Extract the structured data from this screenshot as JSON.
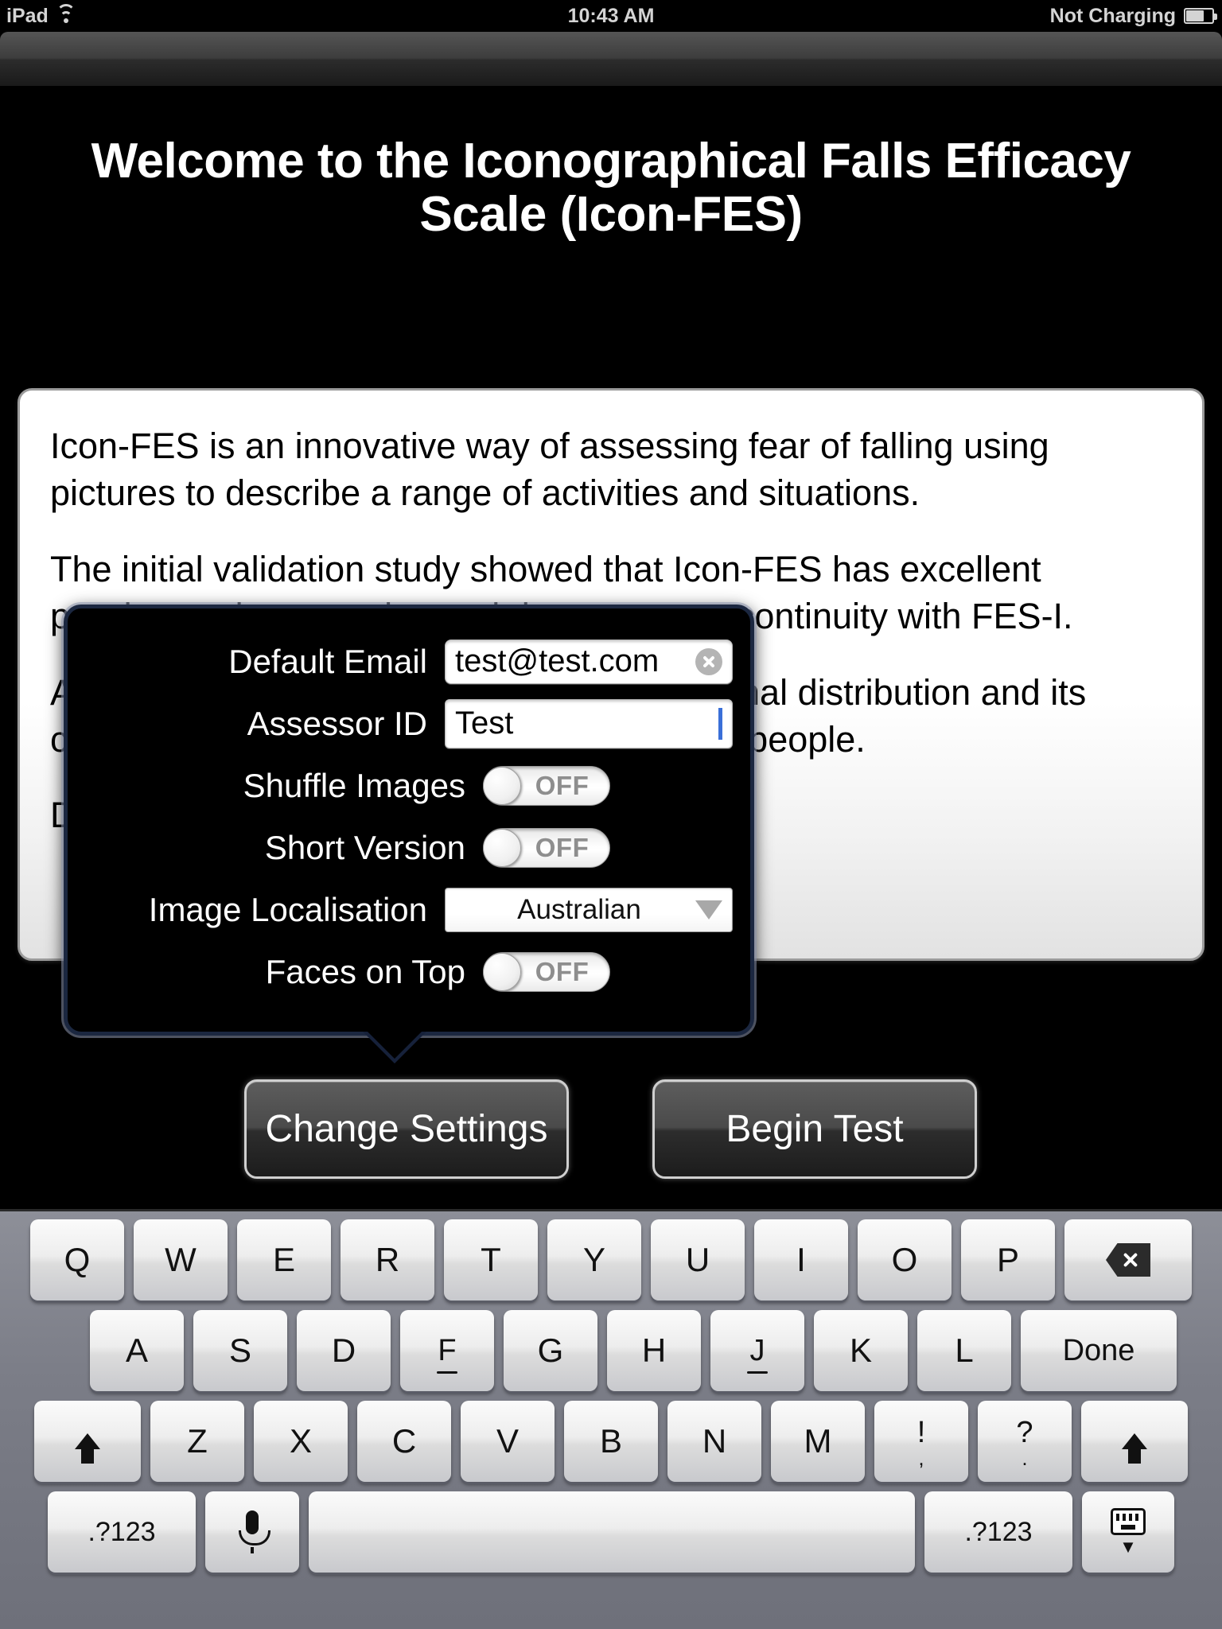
{
  "statusbar": {
    "device": "iPad",
    "wifi_icon": "wifi-icon",
    "time": "10:43 AM",
    "battery_text": "Not Charging",
    "battery_icon": "battery-icon"
  },
  "page_title": "Welcome to the Iconographical Falls Efficacy Scale (Icon-FES)",
  "info_card": {
    "paragraphs": [
      "Icon-FES is an innovative way of assessing fear of falling using pictures to describe a range of activities and situations.",
      "The initial validation study showed that Icon-FES has excellent psychometric properties and demonstrates continuity with FES-I.",
      "Additionally, the Icon-FES scores show normal distribution and its ceiling effect is low in high-functioning older people.",
      "Download the manual here."
    ]
  },
  "settings_popover": {
    "rows": [
      {
        "label": "Default Email",
        "type": "text",
        "value": "test@test.com",
        "clear_icon": "clear-circle-icon"
      },
      {
        "label": "Assessor ID",
        "type": "text",
        "value": "Test",
        "caret": true
      },
      {
        "label": "Shuffle Images",
        "type": "toggle",
        "value": "OFF"
      },
      {
        "label": "Short Version",
        "type": "toggle",
        "value": "OFF"
      },
      {
        "label": "Image Localisation",
        "type": "select",
        "value": "Australian",
        "options": [
          "Australian"
        ]
      },
      {
        "label": "Faces on Top",
        "type": "toggle",
        "value": "OFF"
      }
    ]
  },
  "actions": {
    "change_settings": "Change Settings",
    "begin_test": "Begin Test"
  },
  "keyboard": {
    "row1": [
      "Q",
      "W",
      "E",
      "R",
      "T",
      "Y",
      "U",
      "I",
      "O",
      "P"
    ],
    "backspace_icon": "backspace-icon",
    "row2": [
      "A",
      "S",
      "D",
      "F",
      "G",
      "H",
      "J",
      "K",
      "L"
    ],
    "done": "Done",
    "row3": [
      "Z",
      "X",
      "C",
      "V",
      "B",
      "N",
      "M"
    ],
    "punct": [
      {
        "main": "!",
        "sub": ","
      },
      {
        "main": "?",
        "sub": "."
      }
    ],
    "shift_icon": "shift-icon",
    "num_left": ".?123",
    "num_right": ".?123",
    "mic_icon": "microphone-icon",
    "space": "",
    "hide_keyboard_icon": "hide-keyboard-icon"
  },
  "colors": {
    "background": "#000000",
    "accent_caret": "#3a6fd8",
    "popover_border": "#1b2740",
    "toggle_text": "#8e8e8e"
  }
}
